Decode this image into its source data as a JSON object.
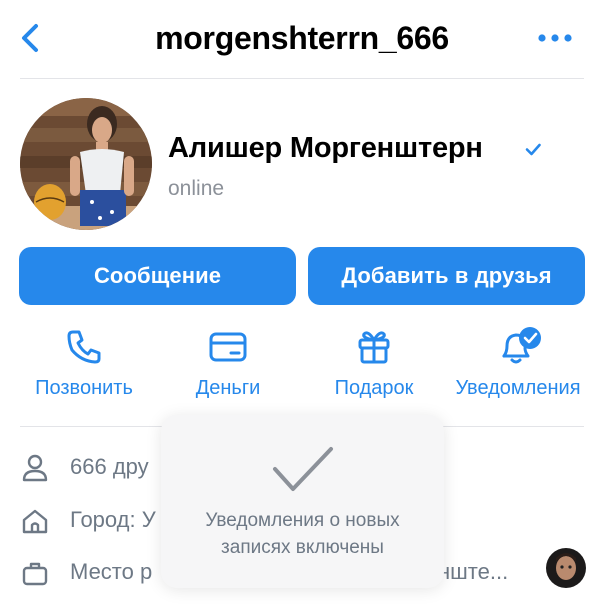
{
  "header": {
    "title": "morgenshterrn_666",
    "back_icon": "chevron-left-icon",
    "more_icon": "more-dots-icon"
  },
  "profile": {
    "name": "Алишер Моргенштерн",
    "status": "online",
    "verified_icon": "verified-check-icon"
  },
  "buttons": {
    "message": "Сообщение",
    "add_friend": "Добавить в друзья"
  },
  "actions": [
    {
      "label": "Позвонить",
      "icon": "phone-icon"
    },
    {
      "label": "Деньги",
      "icon": "card-icon"
    },
    {
      "label": "Подарок",
      "icon": "gift-icon"
    },
    {
      "label": "Уведомления",
      "icon": "bell-checked-icon"
    }
  ],
  "info": {
    "friends": "666 дру",
    "city": "Город: У",
    "work": "Место р",
    "work_tail": "нште..."
  },
  "toast": {
    "text": "Уведомления о новых записях включены",
    "icon": "checkmark-icon"
  },
  "colors": {
    "accent": "#2688eb",
    "secondary_text": "#6d7885",
    "divider": "#e3e4e8",
    "toast_bg": "#f6f6f7"
  }
}
